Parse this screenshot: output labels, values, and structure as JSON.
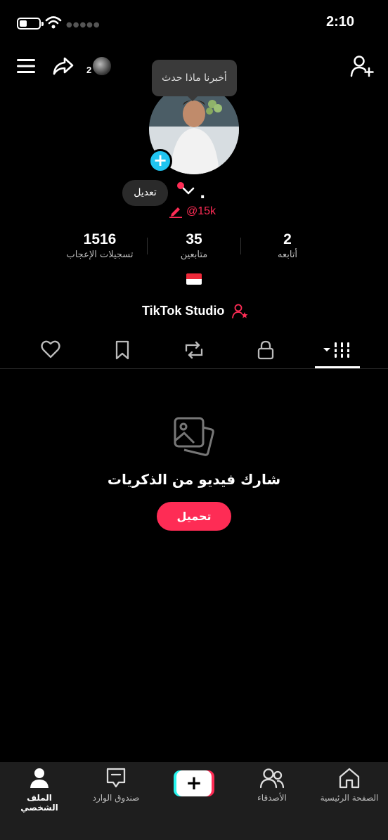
{
  "status_bar": {
    "time": "2:10"
  },
  "header": {
    "friends_badge_count": "2"
  },
  "tooltip": {
    "text": "أخبرنا ماذا حدث"
  },
  "profile": {
    "edit_label": "تعديل",
    "display_name": ".",
    "handle": "@15k",
    "stats": [
      {
        "value": "1516",
        "label": "تسجيلات الإعجاب"
      },
      {
        "value": "35",
        "label": "متابعين"
      },
      {
        "value": "2",
        "label": "أتابعه"
      }
    ],
    "country_flag": "singapore-flag",
    "studio_label": "TikTok Studio"
  },
  "tabs": [
    {
      "name": "liked",
      "icon": "heart-icon"
    },
    {
      "name": "favorites",
      "icon": "bookmark-icon"
    },
    {
      "name": "reposts",
      "icon": "repost-icon"
    },
    {
      "name": "private",
      "icon": "lock-icon"
    },
    {
      "name": "videos",
      "icon": "grid-icon",
      "active": true
    }
  ],
  "empty_state": {
    "title": "شارك فيديو من الذكريات",
    "button_label": "تحميل"
  },
  "bottom_nav": {
    "items": [
      {
        "label": "الملف الشخصي",
        "icon": "person-icon",
        "active": true
      },
      {
        "label": "صندوق الوارد",
        "icon": "inbox-icon"
      },
      {
        "label": "",
        "icon": "plus-icon"
      },
      {
        "label": "الأصدقاء",
        "icon": "friends-icon"
      },
      {
        "label": "الصفحة الرئيسية",
        "icon": "home-icon"
      }
    ]
  },
  "colors": {
    "accent": "#fe2c55",
    "cyan": "#25f4ee",
    "add_button": "#20c4f0"
  }
}
